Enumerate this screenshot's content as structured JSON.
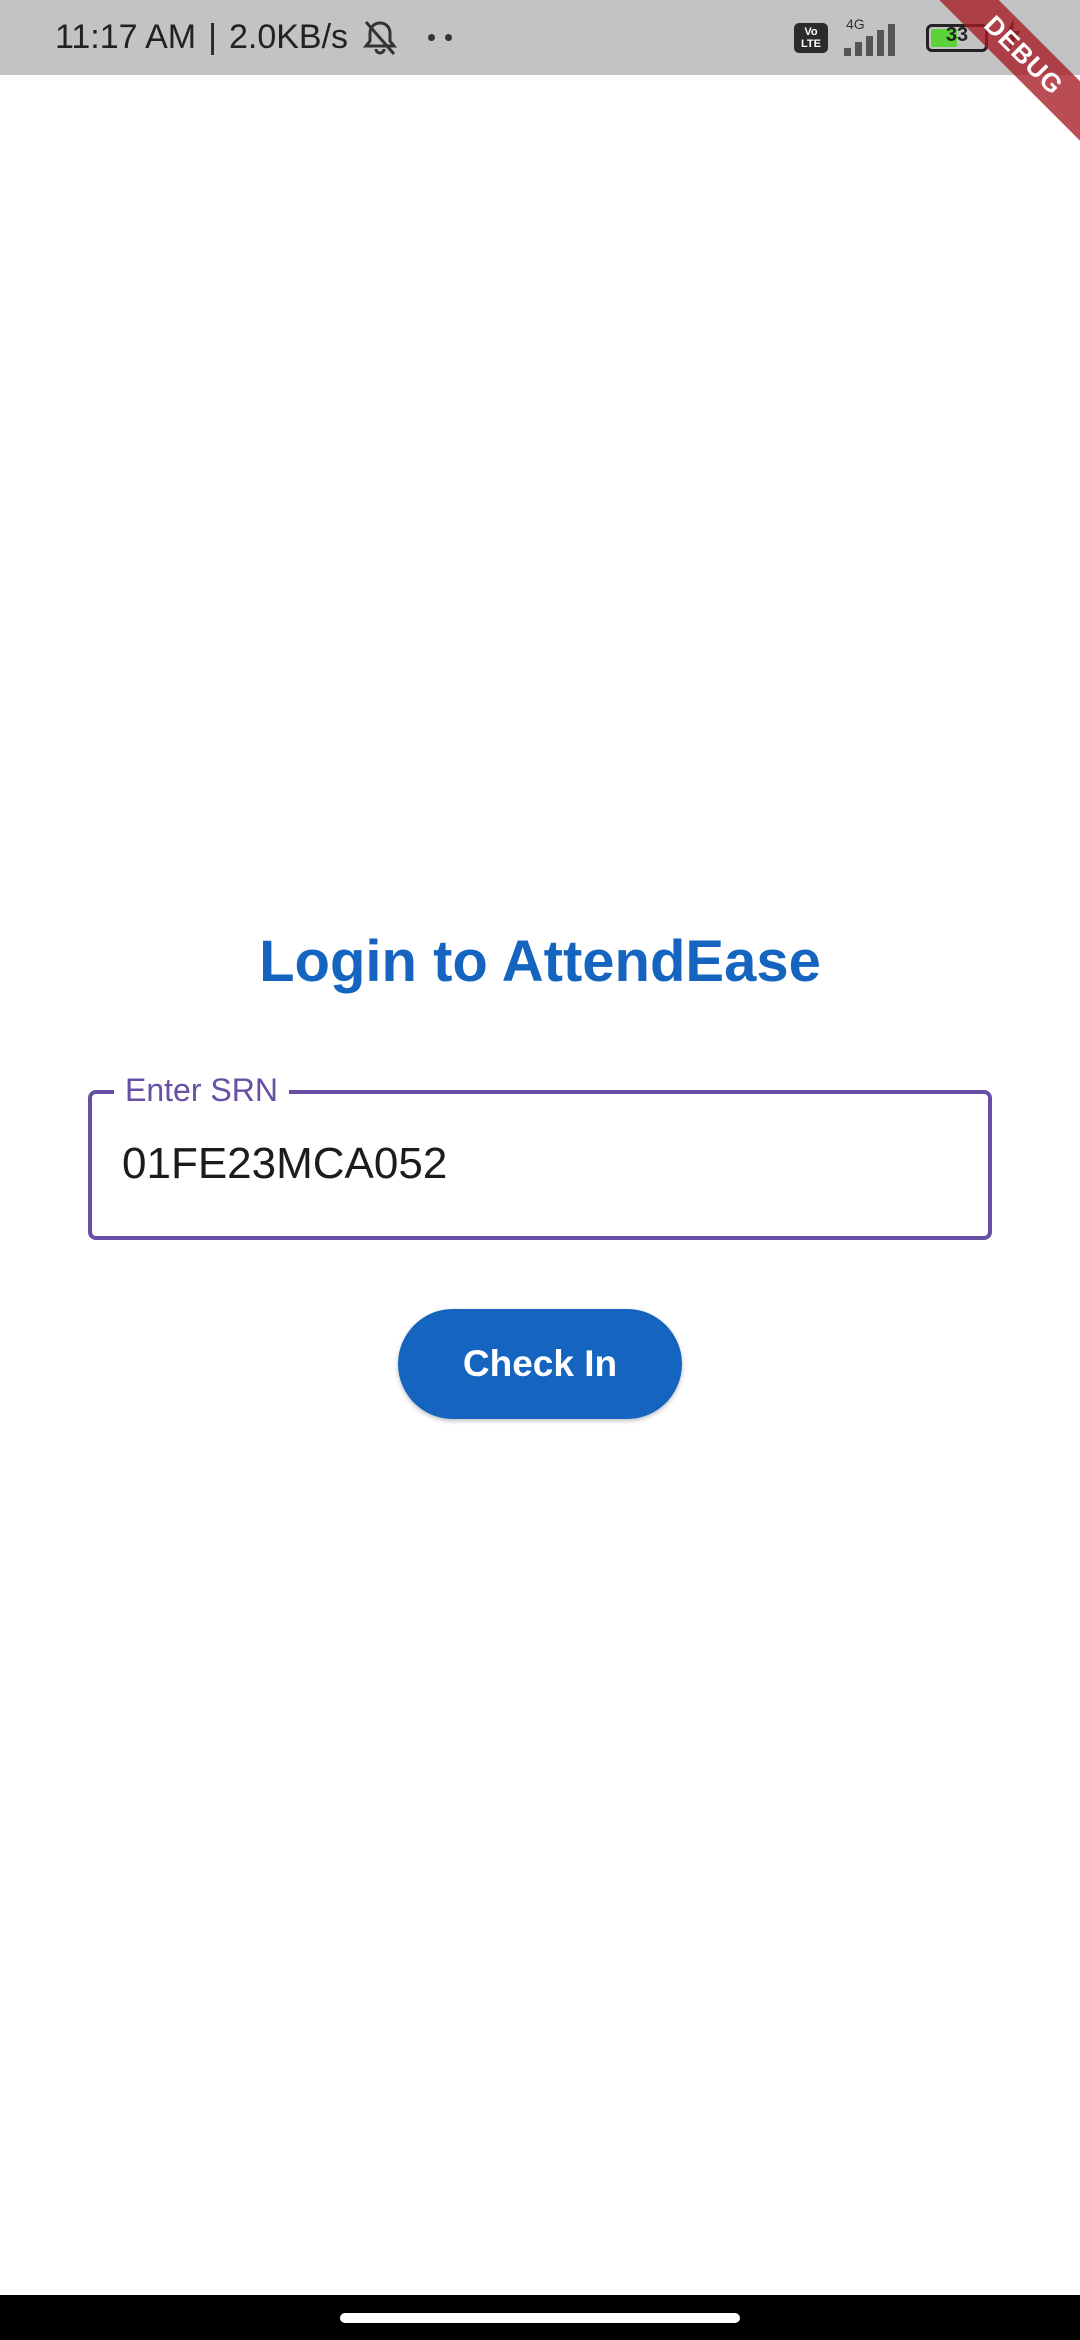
{
  "status_bar": {
    "time": "11:17 AM",
    "separator": "|",
    "network_speed": "2.0KB/s",
    "volte_top": "Vo",
    "volte_bottom": "LTE",
    "network_type": "4G",
    "battery_level": "33",
    "battery_fraction": 0.33,
    "icons": [
      "bell-off-icon",
      "more-dots-icon",
      "volte-icon",
      "signal-icon",
      "battery-icon",
      "charging-icon"
    ]
  },
  "debug_banner": {
    "label": "DEBUG",
    "color": "#a61924"
  },
  "login": {
    "title": "Login to AttendEase",
    "srn_label": "Enter SRN",
    "srn_value": "01FE23MCA052",
    "submit_label": "Check In"
  },
  "colors": {
    "primary": "#1565c0",
    "field_outline": "#6750a4"
  }
}
